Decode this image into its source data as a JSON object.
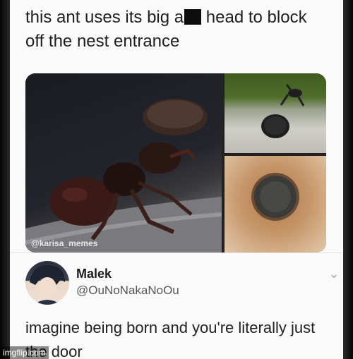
{
  "post": {
    "line1_before": "this ant uses its big a",
    "line1_after": " head to block",
    "line2": "off the nest entrance"
  },
  "images": {
    "watermark": "@karisa_memes"
  },
  "tweet": {
    "name": "Malek",
    "handle": "@OuNoNakaNoOu",
    "text": "imagine being born and you're literally just the door"
  },
  "footer": {
    "site": "imgflip.com"
  }
}
